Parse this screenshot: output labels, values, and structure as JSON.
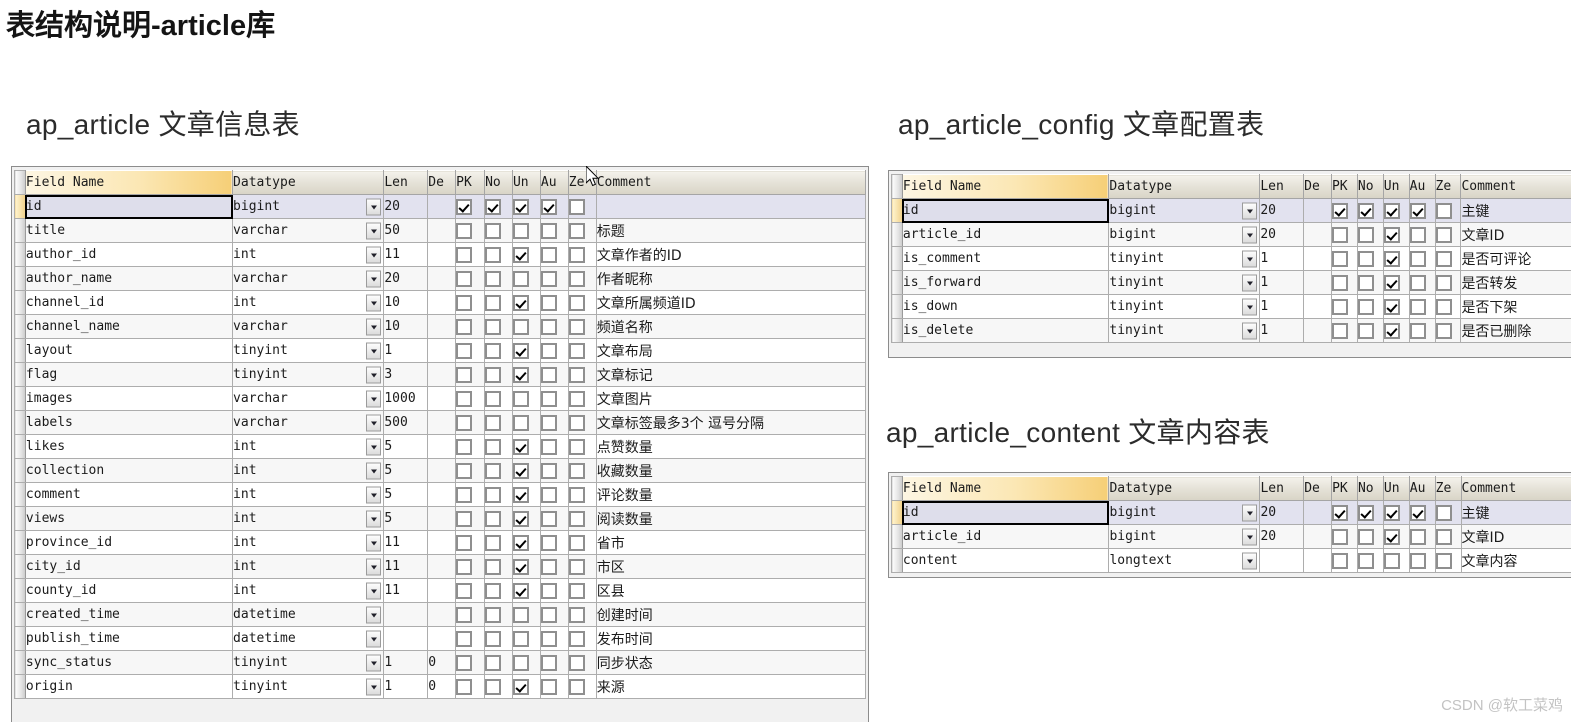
{
  "page": {
    "title": "表结构说明-article库",
    "watermark": "CSDN @软工菜鸡"
  },
  "columns": {
    "field_name": "Field Name",
    "datatype": "Datatype",
    "len": "Len",
    "de": "De",
    "pk": "PK",
    "no": "No",
    "un": "Un",
    "au": "Au",
    "ze": "Ze",
    "comment": "Comment"
  },
  "tables": [
    {
      "id": "ap_article",
      "heading": "ap_article  文章信息表",
      "rows": [
        {
          "field": "id",
          "datatype": "bigint",
          "len": "20",
          "de": "",
          "pk": true,
          "no": true,
          "un": true,
          "au": true,
          "ze": false,
          "comment": ""
        },
        {
          "field": "title",
          "datatype": "varchar",
          "len": "50",
          "de": "",
          "pk": false,
          "no": false,
          "un": false,
          "au": false,
          "ze": false,
          "comment": "标题"
        },
        {
          "field": "author_id",
          "datatype": "int",
          "len": "11",
          "de": "",
          "pk": false,
          "no": false,
          "un": true,
          "au": false,
          "ze": false,
          "comment": "文章作者的ID"
        },
        {
          "field": "author_name",
          "datatype": "varchar",
          "len": "20",
          "de": "",
          "pk": false,
          "no": false,
          "un": false,
          "au": false,
          "ze": false,
          "comment": "作者昵称"
        },
        {
          "field": "channel_id",
          "datatype": "int",
          "len": "10",
          "de": "",
          "pk": false,
          "no": false,
          "un": true,
          "au": false,
          "ze": false,
          "comment": "文章所属频道ID"
        },
        {
          "field": "channel_name",
          "datatype": "varchar",
          "len": "10",
          "de": "",
          "pk": false,
          "no": false,
          "un": false,
          "au": false,
          "ze": false,
          "comment": "频道名称"
        },
        {
          "field": "layout",
          "datatype": "tinyint",
          "len": "1",
          "de": "",
          "pk": false,
          "no": false,
          "un": true,
          "au": false,
          "ze": false,
          "comment": "文章布局"
        },
        {
          "field": "flag",
          "datatype": "tinyint",
          "len": "3",
          "de": "",
          "pk": false,
          "no": false,
          "un": true,
          "au": false,
          "ze": false,
          "comment": "文章标记"
        },
        {
          "field": "images",
          "datatype": "varchar",
          "len": "1000",
          "de": "",
          "pk": false,
          "no": false,
          "un": false,
          "au": false,
          "ze": false,
          "comment": "文章图片"
        },
        {
          "field": "labels",
          "datatype": "varchar",
          "len": "500",
          "de": "",
          "pk": false,
          "no": false,
          "un": false,
          "au": false,
          "ze": false,
          "comment": "文章标签最多3个 逗号分隔"
        },
        {
          "field": "likes",
          "datatype": "int",
          "len": "5",
          "de": "",
          "pk": false,
          "no": false,
          "un": true,
          "au": false,
          "ze": false,
          "comment": "点赞数量"
        },
        {
          "field": "collection",
          "datatype": "int",
          "len": "5",
          "de": "",
          "pk": false,
          "no": false,
          "un": true,
          "au": false,
          "ze": false,
          "comment": "收藏数量"
        },
        {
          "field": "comment",
          "datatype": "int",
          "len": "5",
          "de": "",
          "pk": false,
          "no": false,
          "un": true,
          "au": false,
          "ze": false,
          "comment": "评论数量"
        },
        {
          "field": "views",
          "datatype": "int",
          "len": "5",
          "de": "",
          "pk": false,
          "no": false,
          "un": true,
          "au": false,
          "ze": false,
          "comment": "阅读数量"
        },
        {
          "field": "province_id",
          "datatype": "int",
          "len": "11",
          "de": "",
          "pk": false,
          "no": false,
          "un": true,
          "au": false,
          "ze": false,
          "comment": "省市"
        },
        {
          "field": "city_id",
          "datatype": "int",
          "len": "11",
          "de": "",
          "pk": false,
          "no": false,
          "un": true,
          "au": false,
          "ze": false,
          "comment": "市区"
        },
        {
          "field": "county_id",
          "datatype": "int",
          "len": "11",
          "de": "",
          "pk": false,
          "no": false,
          "un": true,
          "au": false,
          "ze": false,
          "comment": "区县"
        },
        {
          "field": "created_time",
          "datatype": "datetime",
          "len": "",
          "de": "",
          "pk": false,
          "no": false,
          "un": false,
          "au": false,
          "ze": false,
          "comment": "创建时间"
        },
        {
          "field": "publish_time",
          "datatype": "datetime",
          "len": "",
          "de": "",
          "pk": false,
          "no": false,
          "un": false,
          "au": false,
          "ze": false,
          "comment": "发布时间"
        },
        {
          "field": "sync_status",
          "datatype": "tinyint",
          "len": "1",
          "de": "0",
          "pk": false,
          "no": false,
          "un": false,
          "au": false,
          "ze": false,
          "comment": "同步状态"
        },
        {
          "field": "origin",
          "datatype": "tinyint",
          "len": "1",
          "de": "0",
          "pk": false,
          "no": false,
          "un": true,
          "au": false,
          "ze": false,
          "comment": "来源"
        }
      ]
    },
    {
      "id": "ap_article_config",
      "heading": "ap_article_config   文章配置表",
      "rows": [
        {
          "field": "id",
          "datatype": "bigint",
          "len": "20",
          "de": "",
          "pk": true,
          "no": true,
          "un": true,
          "au": true,
          "ze": false,
          "comment": "主键"
        },
        {
          "field": "article_id",
          "datatype": "bigint",
          "len": "20",
          "de": "",
          "pk": false,
          "no": false,
          "un": true,
          "au": false,
          "ze": false,
          "comment": "文章ID"
        },
        {
          "field": "is_comment",
          "datatype": "tinyint",
          "len": "1",
          "de": "",
          "pk": false,
          "no": false,
          "un": true,
          "au": false,
          "ze": false,
          "comment": "是否可评论"
        },
        {
          "field": "is_forward",
          "datatype": "tinyint",
          "len": "1",
          "de": "",
          "pk": false,
          "no": false,
          "un": true,
          "au": false,
          "ze": false,
          "comment": "是否转发"
        },
        {
          "field": "is_down",
          "datatype": "tinyint",
          "len": "1",
          "de": "",
          "pk": false,
          "no": false,
          "un": true,
          "au": false,
          "ze": false,
          "comment": "是否下架"
        },
        {
          "field": "is_delete",
          "datatype": "tinyint",
          "len": "1",
          "de": "",
          "pk": false,
          "no": false,
          "un": true,
          "au": false,
          "ze": false,
          "comment": "是否已删除"
        }
      ]
    },
    {
      "id": "ap_article_content",
      "heading": "ap_article_content  文章内容表",
      "rows": [
        {
          "field": "id",
          "datatype": "bigint",
          "len": "20",
          "de": "",
          "pk": true,
          "no": true,
          "un": true,
          "au": true,
          "ze": false,
          "comment": "主键"
        },
        {
          "field": "article_id",
          "datatype": "bigint",
          "len": "20",
          "de": "",
          "pk": false,
          "no": false,
          "un": true,
          "au": false,
          "ze": false,
          "comment": "文章ID"
        },
        {
          "field": "content",
          "datatype": "longtext",
          "len": "",
          "de": "",
          "pk": false,
          "no": false,
          "un": false,
          "au": false,
          "ze": false,
          "comment": "文章内容"
        }
      ]
    }
  ]
}
